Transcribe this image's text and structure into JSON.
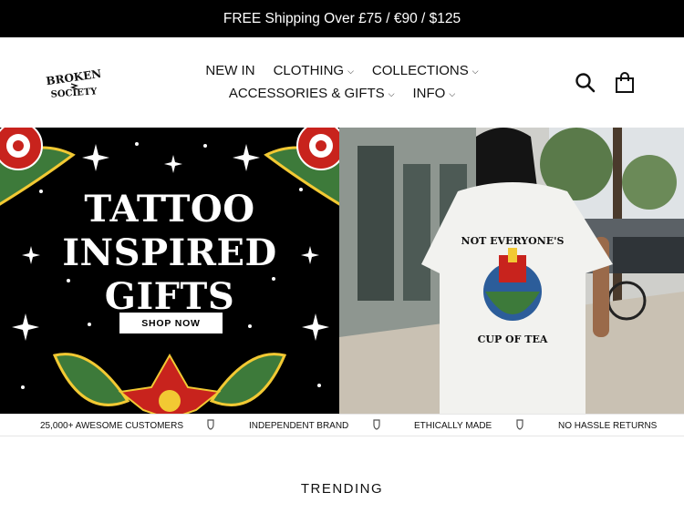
{
  "announcement": {
    "text": "FREE Shipping Over £75 / €90 / $125"
  },
  "header": {
    "logo": {
      "line1": "BROKEN",
      "line2": "SOCIETY"
    },
    "nav_row1": [
      {
        "label": "NEW IN",
        "has_dropdown": false
      },
      {
        "label": "CLOTHING",
        "has_dropdown": true
      },
      {
        "label": "COLLECTIONS",
        "has_dropdown": true
      }
    ],
    "nav_row2": [
      {
        "label": "ACCESSORIES & GIFTS",
        "has_dropdown": true
      },
      {
        "label": "INFO",
        "has_dropdown": true
      }
    ],
    "icons": {
      "search": "search-icon",
      "cart": "shopping-bag-icon"
    }
  },
  "hero": {
    "title_line1": "TATTOO",
    "title_line2": "INSPIRED",
    "title_line3": "GIFTS",
    "cta_label": "SHOP NOW",
    "shirt_text_top": "NOT EVERYONE'S",
    "shirt_text_bottom": "CUP OF TEA"
  },
  "usp": [
    "25,000+ AWESOME CUSTOMERS",
    "INDEPENDENT BRAND",
    "ETHICALLY MADE",
    "NO HASSLE RETURNS"
  ],
  "section": {
    "trending_title": "TRENDING"
  },
  "colors": {
    "announce_bg": "#000000",
    "hero_left_bg": "#000000",
    "flower_red": "#c8231d",
    "leaf_green": "#3d7a3a"
  }
}
